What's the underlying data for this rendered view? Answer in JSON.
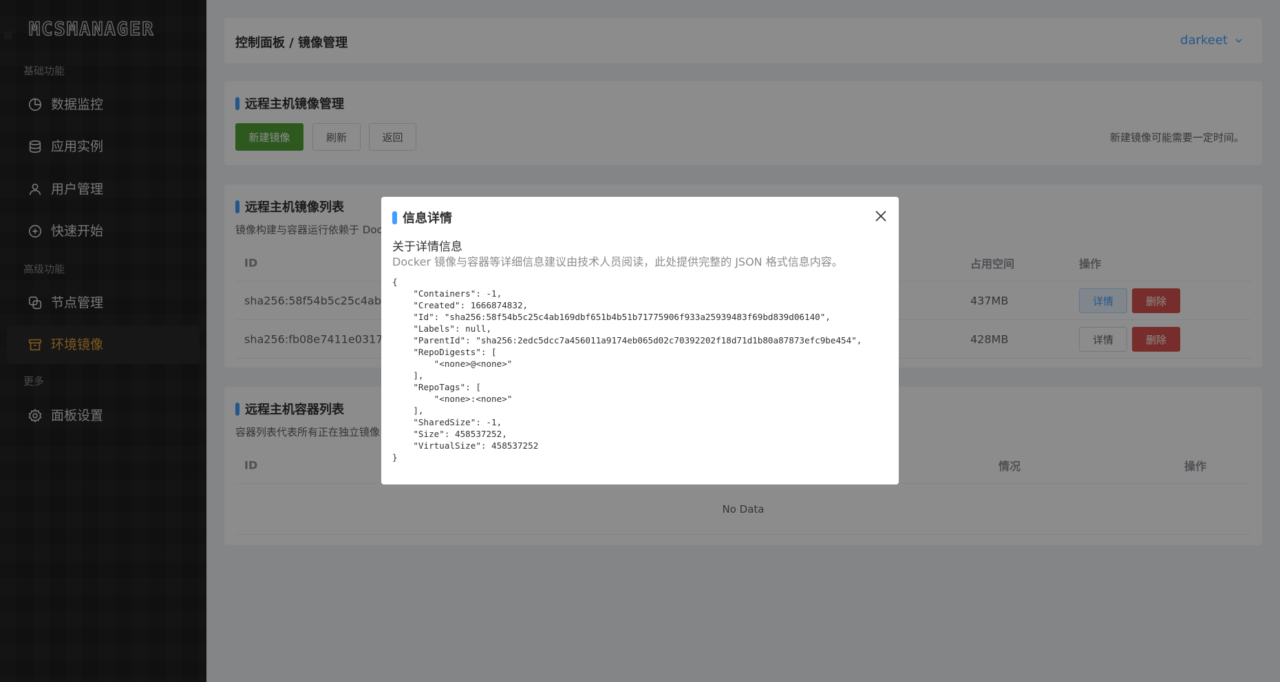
{
  "sidebar": {
    "logo": "MCSMANAGER",
    "sections": {
      "basic": "基础功能",
      "advanced": "高级功能",
      "more": "更多"
    },
    "items": [
      {
        "label": "数据监控",
        "icon": "pie-chart-icon"
      },
      {
        "label": "应用实例",
        "icon": "database-icon"
      },
      {
        "label": "用户管理",
        "icon": "user-icon"
      },
      {
        "label": "快速开始",
        "icon": "plus-circle-icon"
      },
      {
        "label": "节点管理",
        "icon": "nodes-icon"
      },
      {
        "label": "环境镜像",
        "icon": "box-icon",
        "active": true
      },
      {
        "label": "面板设置",
        "icon": "gear-icon"
      }
    ]
  },
  "header": {
    "breadcrumb": "控制面板 / 镜像管理",
    "user": "darkeet"
  },
  "image_manage": {
    "title": "远程主机镜像管理",
    "buttons": {
      "new": "新建镜像",
      "refresh": "刷新",
      "back": "返回"
    },
    "hint": "新建镜像可能需要一定时间。"
  },
  "image_list": {
    "title": "远程主机镜像列表",
    "desc": "镜像构建与容器运行依赖于 Doc",
    "columns": {
      "id": "ID",
      "size": "占用空间",
      "action": "操作"
    },
    "rows": [
      {
        "id": "sha256:58f54b5c25c4ab169d",
        "size": "437MB"
      },
      {
        "id": "sha256:fb08e7411e03173b15",
        "size": "428MB"
      }
    ],
    "detail_label": "详情",
    "delete_label": "删除"
  },
  "container_list": {
    "title": "远程主机容器列表",
    "desc": "容器列表代表所有正在独立镜像",
    "columns": {
      "id": "ID",
      "status": "情况",
      "action": "操作"
    },
    "empty": "No Data"
  },
  "modal": {
    "title": "信息详情",
    "subtitle": "关于详情信息",
    "desc": "Docker 镜像与容器等详细信息建议由技术人员阅读，此处提供完整的 JSON 格式信息内容。",
    "json": "{\n    \"Containers\": -1,\n    \"Created\": 1666874832,\n    \"Id\": \"sha256:58f54b5c25c4ab169dbf651b4b51b71775906f933a25939483f69bd839d06140\",\n    \"Labels\": null,\n    \"ParentId\": \"sha256:2edc5dcc7a456011a9174eb065d02c70392202f18d71d1b80a87873efc9be454\",\n    \"RepoDigests\": [\n        \"<none>@<none>\"\n    ],\n    \"RepoTags\": [\n        \"<none>:<none>\"\n    ],\n    \"SharedSize\": -1,\n    \"Size\": 458537252,\n    \"VirtualSize\": 458537252\n}"
  },
  "colors": {
    "accent": "#409eff",
    "active_nav": "#e6a23c",
    "primary_button": "#52a23a",
    "danger_button": "#d9534f"
  }
}
